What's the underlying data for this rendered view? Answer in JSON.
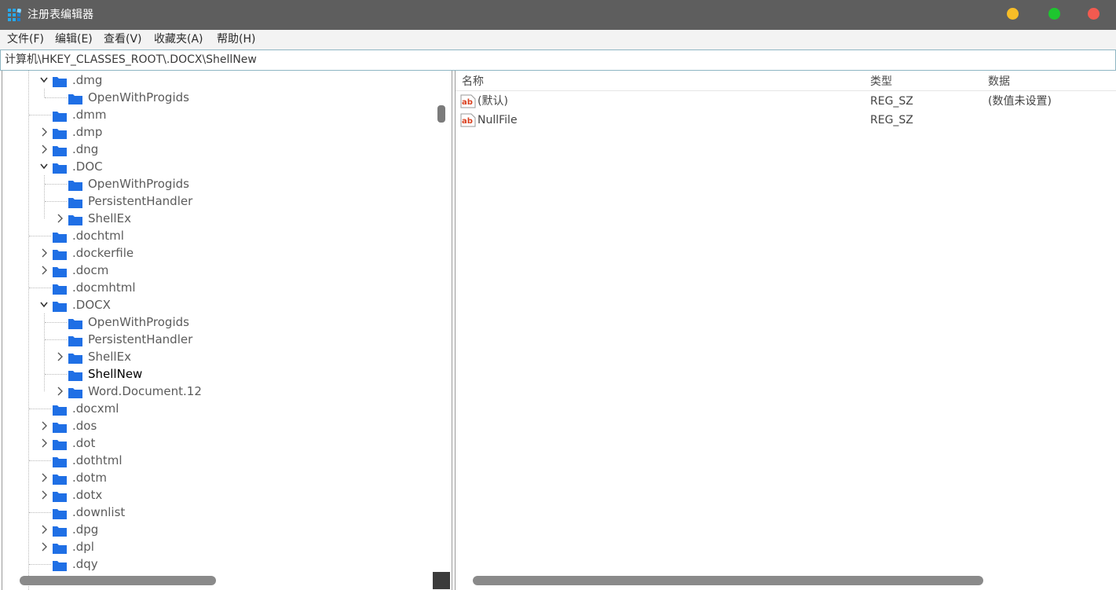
{
  "window": {
    "title": "注册表编辑器",
    "accent_colors": {
      "minimize": "#f7bd27",
      "maximize": "#1ec52f",
      "close": "#f25a50",
      "folder": "#1f6fe5"
    }
  },
  "menu": [
    {
      "label": "文件(F)"
    },
    {
      "label": "编辑(E)"
    },
    {
      "label": "查看(V)"
    },
    {
      "label": "收藏夹(A)"
    },
    {
      "label": "帮助(H)"
    }
  ],
  "address": {
    "path": "计算机\\HKEY_CLASSES_ROOT\\.DOCX\\ShellNew"
  },
  "tree": [
    {
      "label": ".dmg",
      "level": 0,
      "expander": "expanded"
    },
    {
      "label": "OpenWithProgids",
      "level": 1,
      "expander": "none"
    },
    {
      "label": ".dmm",
      "level": 0,
      "expander": "none"
    },
    {
      "label": ".dmp",
      "level": 0,
      "expander": "collapsed"
    },
    {
      "label": ".dng",
      "level": 0,
      "expander": "collapsed"
    },
    {
      "label": ".DOC",
      "level": 0,
      "expander": "expanded"
    },
    {
      "label": "OpenWithProgids",
      "level": 1,
      "expander": "none"
    },
    {
      "label": "PersistentHandler",
      "level": 1,
      "expander": "none"
    },
    {
      "label": "ShellEx",
      "level": 1,
      "expander": "collapsed"
    },
    {
      "label": ".dochtml",
      "level": 0,
      "expander": "none"
    },
    {
      "label": ".dockerfile",
      "level": 0,
      "expander": "collapsed"
    },
    {
      "label": ".docm",
      "level": 0,
      "expander": "collapsed"
    },
    {
      "label": ".docmhtml",
      "level": 0,
      "expander": "none"
    },
    {
      "label": ".DOCX",
      "level": 0,
      "expander": "expanded"
    },
    {
      "label": "OpenWithProgids",
      "level": 1,
      "expander": "none"
    },
    {
      "label": "PersistentHandler",
      "level": 1,
      "expander": "none"
    },
    {
      "label": "ShellEx",
      "level": 1,
      "expander": "collapsed"
    },
    {
      "label": "ShellNew",
      "level": 1,
      "expander": "none",
      "selected": true
    },
    {
      "label": "Word.Document.12",
      "level": 1,
      "expander": "collapsed"
    },
    {
      "label": ".docxml",
      "level": 0,
      "expander": "none"
    },
    {
      "label": ".dos",
      "level": 0,
      "expander": "collapsed"
    },
    {
      "label": ".dot",
      "level": 0,
      "expander": "collapsed"
    },
    {
      "label": ".dothtml",
      "level": 0,
      "expander": "none"
    },
    {
      "label": ".dotm",
      "level": 0,
      "expander": "collapsed"
    },
    {
      "label": ".dotx",
      "level": 0,
      "expander": "collapsed"
    },
    {
      "label": ".downlist",
      "level": 0,
      "expander": "none"
    },
    {
      "label": ".dpg",
      "level": 0,
      "expander": "collapsed"
    },
    {
      "label": ".dpl",
      "level": 0,
      "expander": "collapsed"
    },
    {
      "label": ".dqy",
      "level": 0,
      "expander": "none"
    }
  ],
  "values": {
    "columns": {
      "name": "名称",
      "type": "类型",
      "data": "数据"
    },
    "rows": [
      {
        "name": "(默认)",
        "type": "REG_SZ",
        "data": "(数值未设置)",
        "icon": "string-value-icon"
      },
      {
        "name": "NullFile",
        "type": "REG_SZ",
        "data": "",
        "icon": "string-value-icon"
      }
    ]
  }
}
